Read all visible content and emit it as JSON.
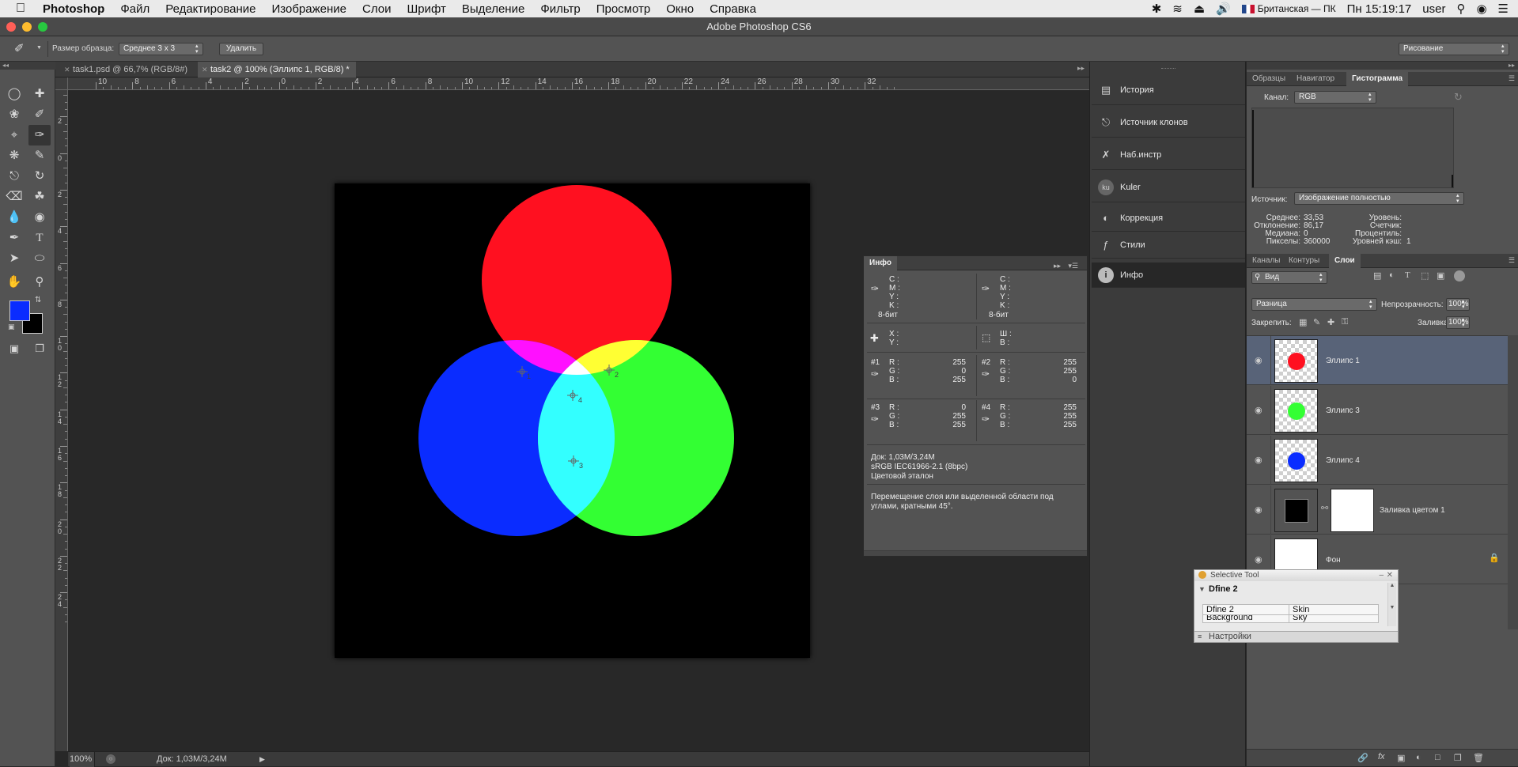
{
  "menubar": {
    "app": "Photoshop",
    "items": [
      "Файл",
      "Редактирование",
      "Изображение",
      "Слои",
      "Шрифт",
      "Выделение",
      "Фильтр",
      "Просмотр",
      "Окно",
      "Справка"
    ],
    "keyboard": "Британская — ПК",
    "clock": "Пн 15:19:17",
    "user": "user"
  },
  "window": {
    "title": "Adobe Photoshop CS6"
  },
  "options": {
    "sample_size_label": "Размер образца:",
    "sample_size_value": "Среднее 3 x 3",
    "delete_label": "Удалить",
    "workspace": "Рисование"
  },
  "tabs": [
    {
      "label": "task1.psd @ 66,7% (RGB/8#)",
      "active": false
    },
    {
      "label": "task2 @ 100% (Эллипс 1, RGB/8) *",
      "active": true
    }
  ],
  "hruler_ticks": [
    "10",
    "8",
    "6",
    "4",
    "2",
    "0",
    "2",
    "4",
    "6",
    "8",
    "10",
    "12",
    "14",
    "16",
    "18",
    "20",
    "22",
    "24",
    "26",
    "28",
    "30",
    "32"
  ],
  "vruler_ticks": [
    "4",
    "2",
    "0",
    "2",
    "4",
    "6",
    "8",
    "1 0",
    "1 2",
    "1 4",
    "1 6",
    "1 8",
    "2 0",
    "2 2",
    "2 4"
  ],
  "colors": {
    "foreground": "#0a2cff",
    "background": "#000000",
    "red": "#ff1020",
    "green": "#33ff33",
    "blue": "#0a2cff",
    "selection": "#586378"
  },
  "samplers": [
    "1",
    "2",
    "4",
    "3"
  ],
  "status": {
    "zoom": "100%",
    "doc": "Док: 1,03M/3,24M"
  },
  "dock": [
    "История",
    "Источник клонов",
    "Наб.инстр",
    "Kuler",
    "Коррекция",
    "Стили",
    "Инфо"
  ],
  "info": {
    "title": "Инфо",
    "cmyk_labels": [
      "C :",
      "M :",
      "Y :",
      "K :"
    ],
    "bit_depth": "8-бит",
    "xy_labels": [
      "X :",
      "Y :"
    ],
    "wh_labels": [
      "Ш :",
      "В :"
    ],
    "rgb_labels": [
      "R :",
      "G :",
      "B :"
    ],
    "samplers": [
      {
        "id": "#1",
        "r": "255",
        "g": "0",
        "b": "255"
      },
      {
        "id": "#2",
        "r": "255",
        "g": "255",
        "b": "0"
      },
      {
        "id": "#3",
        "r": "0",
        "g": "255",
        "b": "255"
      },
      {
        "id": "#4",
        "r": "255",
        "g": "255",
        "b": "255"
      }
    ],
    "doc_size": "Док: 1,03M/3,24M",
    "profile": "sRGB IEC61966-2.1 (8bpc)",
    "timing": "Цветовой эталон",
    "hint": "Перемещение слоя или выделенной области под углами, кратными 45°."
  },
  "histogram_panel": {
    "tabs": [
      "Образцы",
      "Навигатор",
      "Гистограмма"
    ],
    "channel_label": "Канал:",
    "channel": "RGB",
    "source_label": "Источник:",
    "source": "Изображение полностью",
    "stats": [
      {
        "label": "Среднее:",
        "value": "33,53"
      },
      {
        "label": "Отклонение:",
        "value": "86,17"
      },
      {
        "label": "Медиана:",
        "value": "0"
      },
      {
        "label": "Пикселы:",
        "value": "360000"
      }
    ],
    "stats2": [
      {
        "label": "Уровень:",
        "value": ""
      },
      {
        "label": "Счетчик:",
        "value": ""
      },
      {
        "label": "Процентиль:",
        "value": ""
      },
      {
        "label": "Уровней кэш:",
        "value": "1"
      }
    ]
  },
  "layers_panel": {
    "tabs": [
      "Каналы",
      "Контуры",
      "Слои"
    ],
    "filter": "Вид",
    "blend": "Разница",
    "opacity_label": "Непрозрачность:",
    "opacity": "100%",
    "lock_label": "Закрепить:",
    "fill_label": "Заливка:",
    "fill": "100%",
    "layers": [
      {
        "name": "Эллипс 1",
        "dot": "#ff1020",
        "selected": true
      },
      {
        "name": "Эллипс 3",
        "dot": "#33ff33",
        "selected": false
      },
      {
        "name": "Эллипс 4",
        "dot": "#0a2cff",
        "selected": false
      },
      {
        "name": "Заливка цветом 1",
        "dot": "",
        "selected": false
      },
      {
        "name": "Фон",
        "dot": "",
        "selected": false
      }
    ]
  },
  "selective_tool": {
    "title": "Selective Tool",
    "section": "Dfine 2",
    "rows": [
      {
        "a": "Dfine 2",
        "b": "Skin"
      },
      {
        "a": "Background",
        "b": "Sky"
      }
    ],
    "settings": "Настройки"
  }
}
